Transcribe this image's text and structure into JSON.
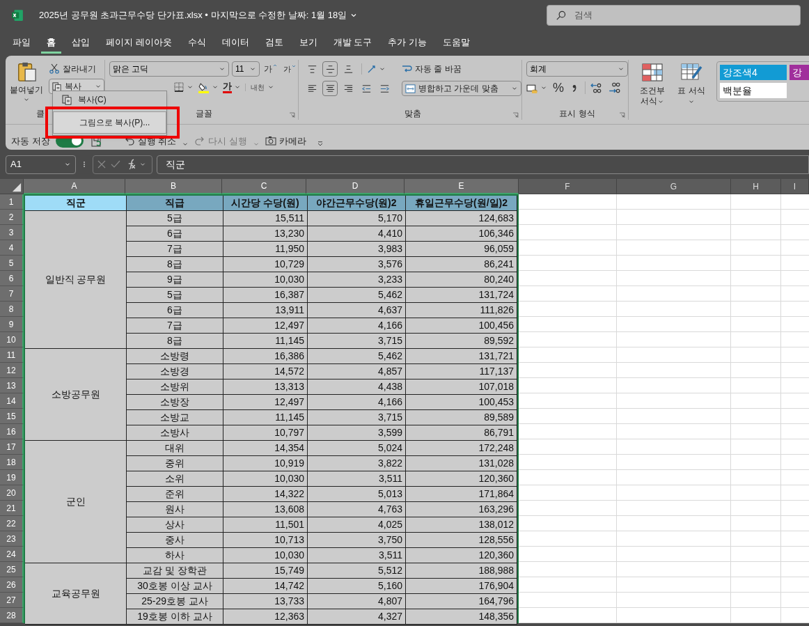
{
  "window": {
    "title": "2025년 공무원 초과근무수당 단가표.xlsx • 마지막으로 수정한 날짜: 1월 18일"
  },
  "search": {
    "placeholder": "검색"
  },
  "tabs": [
    {
      "label": "파일",
      "selected": false
    },
    {
      "label": "홈",
      "selected": true
    },
    {
      "label": "삽입",
      "selected": false
    },
    {
      "label": "페이지 레이아웃",
      "selected": false
    },
    {
      "label": "수식",
      "selected": false
    },
    {
      "label": "데이터",
      "selected": false
    },
    {
      "label": "검토",
      "selected": false
    },
    {
      "label": "보기",
      "selected": false
    },
    {
      "label": "개발 도구",
      "selected": false
    },
    {
      "label": "추가 기능",
      "selected": false
    },
    {
      "label": "도움말",
      "selected": false
    }
  ],
  "ribbon": {
    "clipboard": {
      "paste": "붙여넣기",
      "cut": "잘라내기",
      "copy": "복사",
      "label": "클"
    },
    "font": {
      "name": "맑은 고딕",
      "size": "11",
      "grow": "가",
      "shrink": "가",
      "font_color": "가",
      "phonetic": "내천",
      "label": "글꼴"
    },
    "alignment": {
      "wrap": "자동 줄 바꿈",
      "merge": "병합하고 가운데 맞춤",
      "label": "맞춤"
    },
    "number": {
      "format": "회계",
      "percent": "%",
      "label": "표시 형식"
    },
    "styles": {
      "conditional": "조건부 서식",
      "table": "표 서식",
      "gallery": [
        {
          "label": "강조색4",
          "color": "#129bd4"
        },
        {
          "label": "강",
          "color": "#a02f9c"
        },
        {
          "label": "백분율",
          "color": "#ffffff"
        }
      ]
    }
  },
  "quick_access": {
    "autosave_label": "자동 저장",
    "autosave_on": true,
    "undo": "실행 취소",
    "redo": "다시 실행",
    "redo_disabled": true,
    "camera": "카메라"
  },
  "copy_menu": {
    "items": [
      {
        "label": "복사(C)",
        "selected": false
      },
      {
        "label": "그림으로 복사(P)...",
        "selected": true
      }
    ]
  },
  "formula_bar": {
    "name_box": "A1",
    "formula": "직군"
  },
  "sheet": {
    "columns": [
      {
        "label": "A",
        "selected": true
      },
      {
        "label": "B",
        "selected": true
      },
      {
        "label": "C",
        "selected": true
      },
      {
        "label": "D",
        "selected": true
      },
      {
        "label": "E",
        "selected": true
      },
      {
        "label": "F",
        "selected": false
      },
      {
        "label": "G",
        "selected": false
      },
      {
        "label": "H",
        "selected": false
      },
      {
        "label": "I",
        "selected": false
      }
    ],
    "header": [
      "직군",
      "직급",
      "시간당 수당(원)",
      "야간근무수당(원)2",
      "휴일근무수당(원/일)2"
    ],
    "groups": [
      {
        "name": "일반직 공무원",
        "rows": [
          [
            "5급",
            "15,511",
            "5,170",
            "124,683"
          ],
          [
            "6급",
            "13,230",
            "4,410",
            "106,346"
          ],
          [
            "7급",
            "11,950",
            "3,983",
            "96,059"
          ],
          [
            "8급",
            "10,729",
            "3,576",
            "86,241"
          ],
          [
            "9급",
            "10,030",
            "3,233",
            "80,240"
          ],
          [
            "5급",
            "16,387",
            "5,462",
            "131,724"
          ],
          [
            "6급",
            "13,911",
            "4,637",
            "111,826"
          ],
          [
            "7급",
            "12,497",
            "4,166",
            "100,456"
          ],
          [
            "8급",
            "11,145",
            "3,715",
            "89,592"
          ]
        ]
      },
      {
        "name": "소방공무원",
        "rows": [
          [
            "소방령",
            "16,386",
            "5,462",
            "131,721"
          ],
          [
            "소방경",
            "14,572",
            "4,857",
            "117,137"
          ],
          [
            "소방위",
            "13,313",
            "4,438",
            "107,018"
          ],
          [
            "소방장",
            "12,497",
            "4,166",
            "100,453"
          ],
          [
            "소방교",
            "11,145",
            "3,715",
            "89,589"
          ],
          [
            "소방사",
            "10,797",
            "3,599",
            "86,791"
          ]
        ]
      },
      {
        "name": "군인",
        "rows": [
          [
            "대위",
            "14,354",
            "5,024",
            "172,248"
          ],
          [
            "중위",
            "10,919",
            "3,822",
            "131,028"
          ],
          [
            "소위",
            "10,030",
            "3,511",
            "120,360"
          ],
          [
            "준위",
            "14,322",
            "5,013",
            "171,864"
          ],
          [
            "원사",
            "13,608",
            "4,763",
            "163,296"
          ],
          [
            "상사",
            "11,501",
            "4,025",
            "138,012"
          ],
          [
            "중사",
            "10,713",
            "3,750",
            "128,556"
          ],
          [
            "하사",
            "10,030",
            "3,511",
            "120,360"
          ]
        ]
      },
      {
        "name": "교육공무원",
        "rows": [
          [
            "교감 및 장학관",
            "15,749",
            "5,512",
            "188,988"
          ],
          [
            "30호봉 이상 교사",
            "14,742",
            "5,160",
            "176,904"
          ],
          [
            "25-29호봉 교사",
            "13,733",
            "4,807",
            "164,796"
          ],
          [
            "19호봉 이하 교사",
            "12,363",
            "4,327",
            "148,356"
          ]
        ]
      }
    ],
    "row_numbers": [
      "1",
      "2",
      "3",
      "4",
      "5",
      "6",
      "7",
      "8",
      "9",
      "10",
      "11",
      "12",
      "13",
      "14",
      "15",
      "16",
      "17",
      "18",
      "19",
      "20",
      "21",
      "22",
      "23",
      "24",
      "25",
      "26",
      "27",
      "28"
    ]
  }
}
